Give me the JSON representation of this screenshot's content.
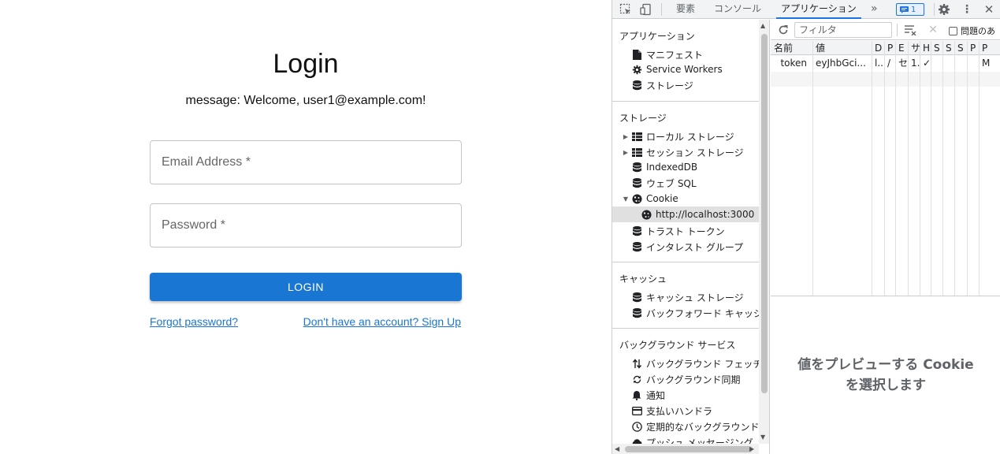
{
  "login": {
    "title": "Login",
    "message": "message: Welcome, user1@example.com!",
    "email_placeholder": "Email Address *",
    "password_placeholder": "Password *",
    "submit_label": "LOGIN",
    "forgot_link": "Forgot password?",
    "signup_link": "Don't have an account? Sign Up",
    "accent_color": "#1976d2"
  },
  "devtools": {
    "tabs": [
      "要素",
      "コンソール",
      "アプリケーション"
    ],
    "more_tabs": "»",
    "issues_count": "1",
    "filter_placeholder": "フィルタ",
    "issues_checkbox_label": "問題のあ",
    "sidebar": {
      "sections": [
        {
          "header": "アプリケーション",
          "items": [
            {
              "label": "マニフェスト",
              "icon": "document-icon"
            },
            {
              "label": "Service Workers",
              "icon": "gear-icon"
            },
            {
              "label": "ストレージ",
              "icon": "database-icon"
            }
          ]
        },
        {
          "header": "ストレージ",
          "items": [
            {
              "label": "ローカル ストレージ",
              "icon": "grid-icon"
            },
            {
              "label": "セッション ストレージ",
              "icon": "grid-icon"
            },
            {
              "label": "IndexedDB",
              "icon": "database-icon"
            },
            {
              "label": "ウェブ SQL",
              "icon": "database-icon"
            },
            {
              "label": "Cookie",
              "icon": "cookie-icon"
            },
            {
              "label": "http://localhost:3000",
              "icon": "cookie-icon"
            },
            {
              "label": "トラスト トークン",
              "icon": "database-icon"
            },
            {
              "label": "インタレスト グループ",
              "icon": "database-icon"
            }
          ]
        },
        {
          "header": "キャッシュ",
          "items": [
            {
              "label": "キャッシュ ストレージ",
              "icon": "database-icon"
            },
            {
              "label": "バックフォワード キャッシ",
              "icon": "database-icon"
            }
          ]
        },
        {
          "header": "バックグラウンド サービス",
          "items": [
            {
              "label": "バックグラウンド フェッチ",
              "icon": "updown-arrows-icon"
            },
            {
              "label": "バックグラウンド同期",
              "icon": "sync-icon"
            },
            {
              "label": "通知",
              "icon": "bell-icon"
            },
            {
              "label": "支払いハンドラ",
              "icon": "card-icon"
            },
            {
              "label": "定期的なバックグラウンド",
              "icon": "clock-icon"
            },
            {
              "label": "プッシュ メッセージング",
              "icon": "cloud-icon"
            }
          ]
        }
      ]
    },
    "cookie_table": {
      "headers": [
        "名前",
        "値",
        "D",
        "P",
        "E",
        "サ",
        "H",
        "S",
        "S",
        "S",
        "P",
        "P"
      ],
      "rows": [
        [
          "token",
          "eyJhbGci...",
          "l..",
          "/",
          "セ",
          "1..",
          "✓",
          "",
          "",
          "",
          "",
          "M"
        ]
      ]
    },
    "preview_message": "値をプレビューする Cookie を選択します"
  }
}
